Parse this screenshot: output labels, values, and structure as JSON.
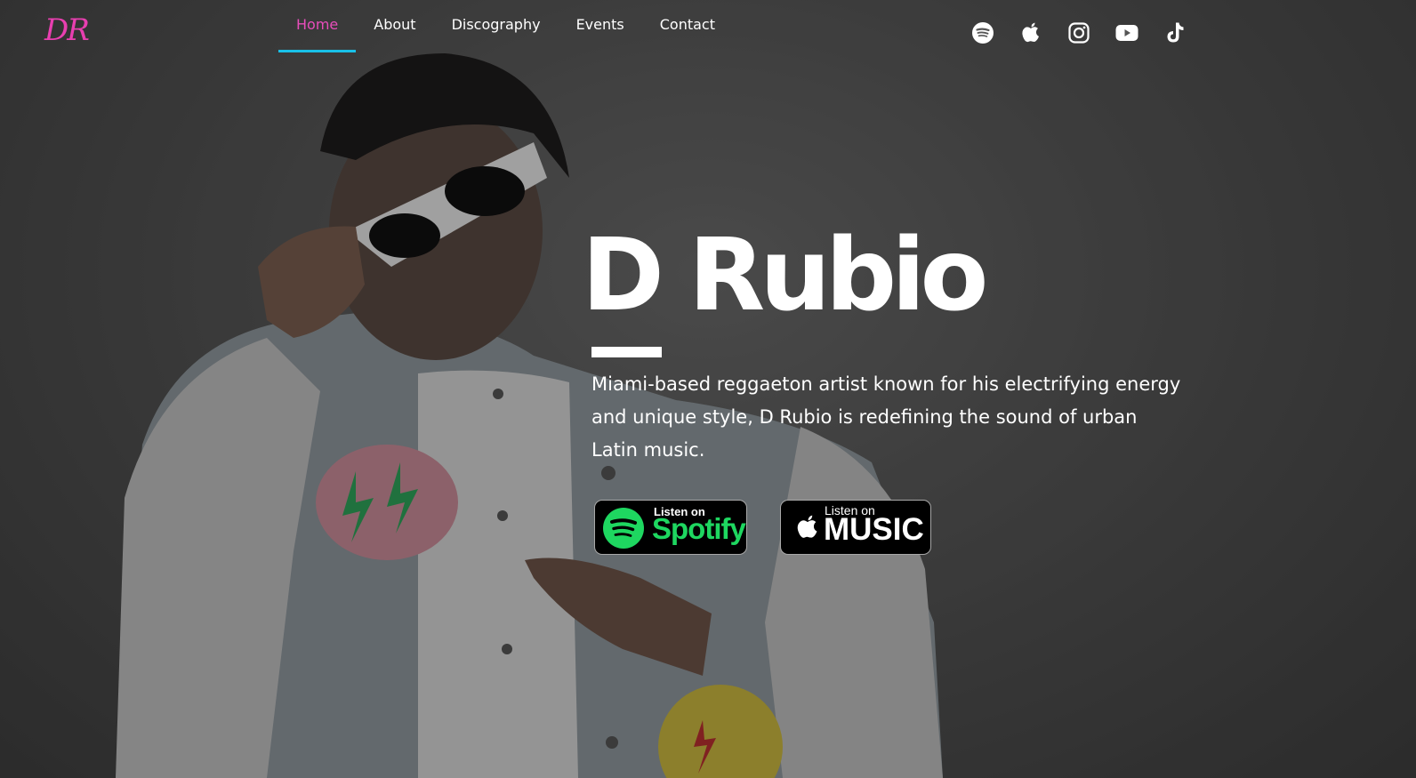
{
  "logo": {
    "text": "DR",
    "color": "#e83fb0"
  },
  "nav": {
    "items": [
      {
        "label": "Home",
        "active": true
      },
      {
        "label": "About",
        "active": false
      },
      {
        "label": "Discography",
        "active": false
      },
      {
        "label": "Events",
        "active": false
      },
      {
        "label": "Contact",
        "active": false
      }
    ],
    "active_color": "#e84dbb",
    "underline_color": "#19c0e8"
  },
  "social_icons": [
    "spotify-icon",
    "apple-icon",
    "instagram-icon",
    "youtube-icon",
    "tiktok-icon"
  ],
  "hero": {
    "title": "D Rubio",
    "description": "Miami-based reggaeton artist known for his electrifying energy and unique style, D Rubio is redefining the sound of urban Latin music."
  },
  "badges": {
    "spotify": {
      "small": "Listen on",
      "big": "Spotify",
      "color": "#1ed760"
    },
    "apple": {
      "small": "Listen on",
      "big": "MUSIC"
    }
  }
}
